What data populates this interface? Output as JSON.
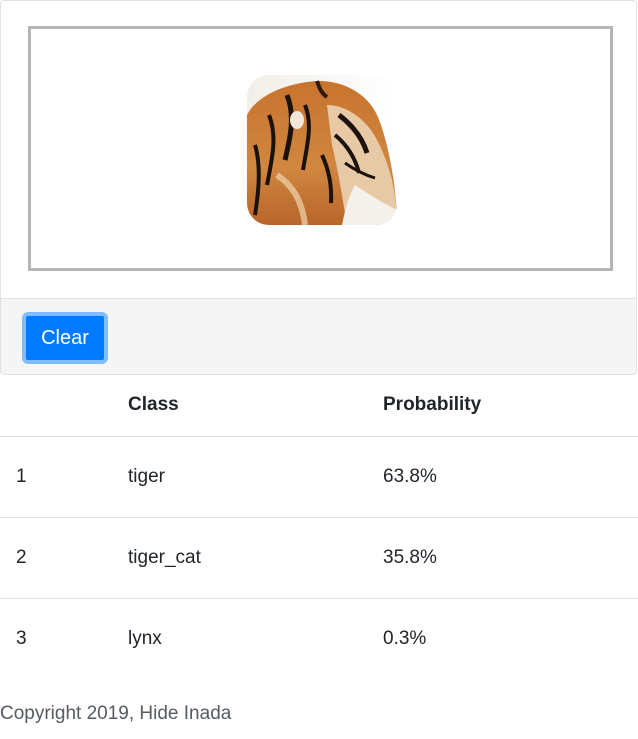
{
  "uploader": {
    "preview_image": "tiger-photo",
    "clear_label": "Clear",
    "button_color": "#007bff"
  },
  "results": {
    "headers": {
      "rank": "",
      "class": "Class",
      "probability": "Probability"
    },
    "rows": [
      {
        "rank": "1",
        "class": "tiger",
        "probability": "63.8%"
      },
      {
        "rank": "2",
        "class": "tiger_cat",
        "probability": "35.8%"
      },
      {
        "rank": "3",
        "class": "lynx",
        "probability": "0.3%"
      }
    ]
  },
  "footer": {
    "copyright": "Copyright 2019, Hide Inada"
  }
}
